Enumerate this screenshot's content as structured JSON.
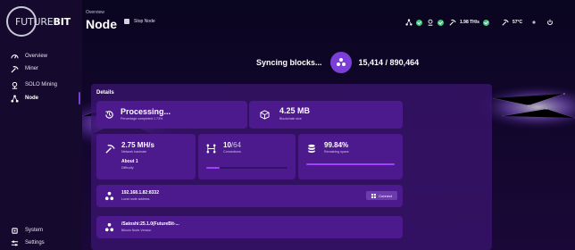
{
  "brand": {
    "name_future": "FUTURE",
    "name_bit": "BIT"
  },
  "sidebar": {
    "items": [
      {
        "label": "Overview",
        "icon": "gauge-icon"
      },
      {
        "label": "Miner",
        "icon": "pickaxe-icon"
      },
      {
        "label": "SOLO Mining",
        "icon": "medal-icon"
      },
      {
        "label": "Node",
        "icon": "network-icon",
        "active": true
      }
    ],
    "bottom": [
      {
        "label": "System",
        "icon": "cpu-icon"
      },
      {
        "label": "Settings",
        "icon": "sliders-icon"
      }
    ]
  },
  "header": {
    "breadcrumb": "Overview",
    "title": "Node",
    "stop_button": "Stop Node"
  },
  "status": {
    "hashrate": "1.98 TH/s",
    "temperature": "57°C"
  },
  "sync": {
    "label": "Syncing blocks...",
    "value": "15,414 / 890,464"
  },
  "details": {
    "title": "Details",
    "processing": {
      "value": "Processing...",
      "sub": "Percentage completed 1.73%"
    },
    "blockchain": {
      "value": "4.25 MB",
      "sub": "Blockchain size"
    },
    "hashrate": {
      "value": "2.75 MH/s",
      "sub": "Network hashrate",
      "value2": "About 1",
      "sub2": "Difficulty"
    },
    "connections": {
      "current": "10",
      "max": "/64",
      "sub": "Connections",
      "fill_fraction": 0.16
    },
    "space": {
      "value": "99.84%",
      "sub": "Remaining space",
      "fill_fraction": 0.998
    },
    "address": {
      "value": "192.168.1.82:8332",
      "sub": "Local node address",
      "button": "Connect"
    },
    "version": {
      "value": "/Satoshi:25.1.0(FutureBit-...",
      "sub": "Bitcoin Node Version"
    }
  },
  "colors": {
    "accent": "#7b3fd8",
    "ok": "#3fc17a",
    "bar": "#a23fff"
  }
}
